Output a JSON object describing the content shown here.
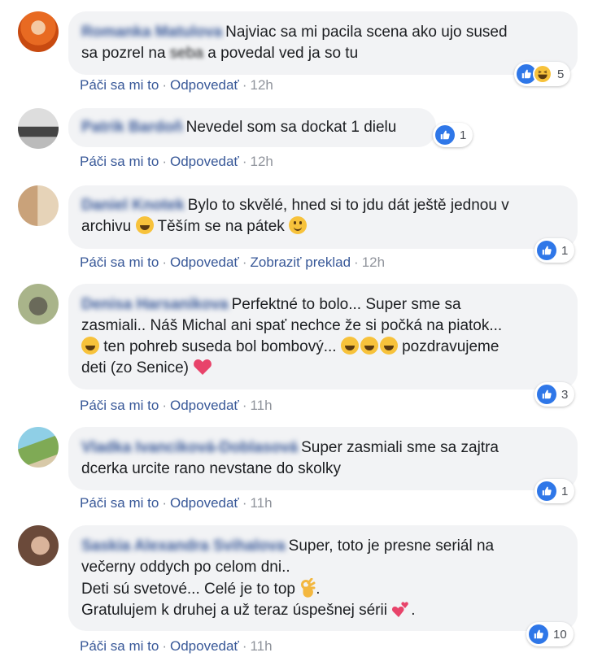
{
  "actions": {
    "like": "Páči sa mi to",
    "reply": "Odpovedať",
    "translate": "Zobraziť preklad"
  },
  "colors": {
    "link": "#385898",
    "bubble": "#f2f3f5",
    "like": "#2f77e8",
    "haha": "#f7c23b",
    "heart": "#e8436a"
  },
  "comments": [
    {
      "author": "Romanka Matulova",
      "line1": "Najviac sa mi pacila scena ako ujo sused",
      "line2a": "sa pozrel na",
      "line2blur": "seba",
      "line2b": "a povedal ved ja so tu",
      "time": "12h",
      "reactions": [
        "like-icon",
        "haha-icon"
      ],
      "reaction_count": "5"
    },
    {
      "author": "Patrik Bardoň",
      "text": "Nevedel som sa dockat 1 dielu",
      "time": "12h",
      "reactions": [
        "like-icon"
      ],
      "reaction_count": "1"
    },
    {
      "author": "Daniel Knotek",
      "line1": "Bylo to skvělé, hned si to jdu dát ještě jednou v",
      "line2a": "archivu",
      "line2b": "Těším se na pátek",
      "time": "12h",
      "reactions": [
        "like-icon"
      ],
      "reaction_count": "1"
    },
    {
      "author": "Denisa Harsanikova",
      "line1": "Perfektné to bolo... Super sme sa",
      "line2": "zasmiali.. Náš Michal ani spať nechce že si počká na piatok...",
      "line3a": "ten pohreb suseda bol bombový...",
      "line3b": "pozdravujeme",
      "line4": "deti (zo Senice)",
      "time": "11h",
      "reactions": [
        "like-icon"
      ],
      "reaction_count": "3"
    },
    {
      "author": "Vladka Ivanciková-Doblasová",
      "line1": "Super zasmiali sme sa zajtra",
      "line2": "dcerka urcite rano nevstane do skolky",
      "time": "11h",
      "reactions": [
        "like-icon"
      ],
      "reaction_count": "1"
    },
    {
      "author": "Saskia Alexandra Svihalova",
      "line1": "Super, toto je presne seriál na",
      "line2": "večerny oddych po celom dni..",
      "line3": "Deti sú svetové... Celé je to top",
      "line4": "Gratulujem k druhej a už teraz úspešnej sérii",
      "time": "11h",
      "reactions": [
        "like-icon"
      ],
      "reaction_count": "10"
    }
  ]
}
